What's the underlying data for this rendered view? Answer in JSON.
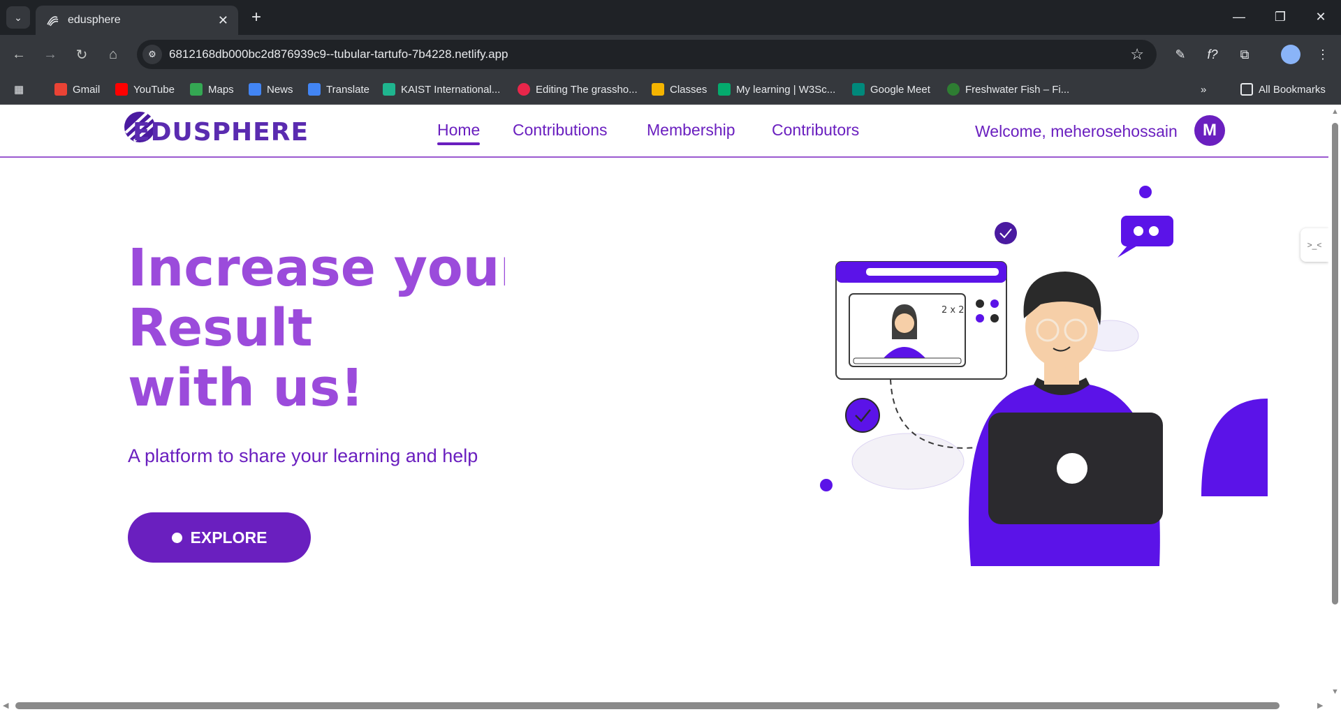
{
  "browser": {
    "tab_title": "edusphere",
    "url": "6812168db000bc2d876939c9--tubular-tartufo-7b4228.netlify.app",
    "bookmarks": [
      {
        "label": "Gmail",
        "color": "#ea4335"
      },
      {
        "label": "YouTube",
        "color": "#ff0000"
      },
      {
        "label": "Maps",
        "color": "#34a853"
      },
      {
        "label": "News",
        "color": "#4285f4"
      },
      {
        "label": "Translate",
        "color": "#4285f4"
      },
      {
        "label": "KAIST International...",
        "color": "#1fb58f"
      },
      {
        "label": "Editing The grassho...",
        "color": "#e8264a"
      },
      {
        "label": "Classes",
        "color": "#f4b400"
      },
      {
        "label": "My learning | W3Sc...",
        "color": "#04aa6d"
      },
      {
        "label": "Google Meet",
        "color": "#00897b"
      },
      {
        "label": "Freshwater Fish – Fi...",
        "color": "#2e7d32"
      }
    ],
    "all_bookmarks": "All Bookmarks"
  },
  "site": {
    "logo_text": "EDUSPHERE",
    "nav": {
      "home": "Home",
      "contributions": "Contributions",
      "membership": "Membership",
      "contributors": "Contributors"
    },
    "welcome": "Welcome, meherosehossain",
    "avatar_initial": "M",
    "accent_color": "#6a1fbf",
    "hero_color": "#9b4bdb"
  },
  "hero": {
    "line1": "Increase your",
    "line2": "Result",
    "line3": "with us!",
    "subtitle": "A platform to share your learning and help others",
    "explore_label": "EXPLORE",
    "illustration_label": "2 x 2"
  }
}
